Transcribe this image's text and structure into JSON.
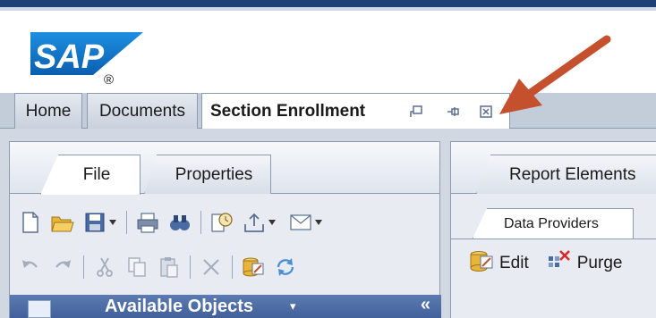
{
  "brand": {
    "logo_text": "SAP",
    "registered_mark": "®"
  },
  "tabs": [
    {
      "label": "Home"
    },
    {
      "label": "Documents"
    },
    {
      "label": "Section Enrollment"
    }
  ],
  "tab_icons": [
    "restore-icon",
    "pin-icon",
    "close-icon"
  ],
  "left_panel": {
    "ribbon_tabs": [
      {
        "label": "File"
      },
      {
        "label": "Properties"
      }
    ],
    "toolbar_row1": [
      "new-document-icon",
      "open-folder-icon",
      "save-icon",
      "print-icon",
      "find-icon",
      "history-icon",
      "export-icon",
      "send-mail-icon"
    ],
    "toolbar_row2": [
      "undo-icon",
      "redo-icon",
      "cut-icon",
      "copy-icon",
      "paste-icon",
      "delete-icon",
      "edit-data-icon",
      "refresh-icon"
    ],
    "section": {
      "title": "Available Objects",
      "caret": "▾",
      "collapse": "«"
    }
  },
  "right_panel": {
    "tab": "Report Elements",
    "subtab": "Data Providers",
    "buttons": [
      {
        "label": "Edit",
        "icon": "edit-provider-icon"
      },
      {
        "label": "Purge",
        "icon": "purge-icon"
      }
    ]
  },
  "colors": {
    "top_bar": "#1f3f77",
    "tabstrip": "#c3ccd9",
    "section_header": "#4a6aa4",
    "arrow": "#c5502e"
  }
}
